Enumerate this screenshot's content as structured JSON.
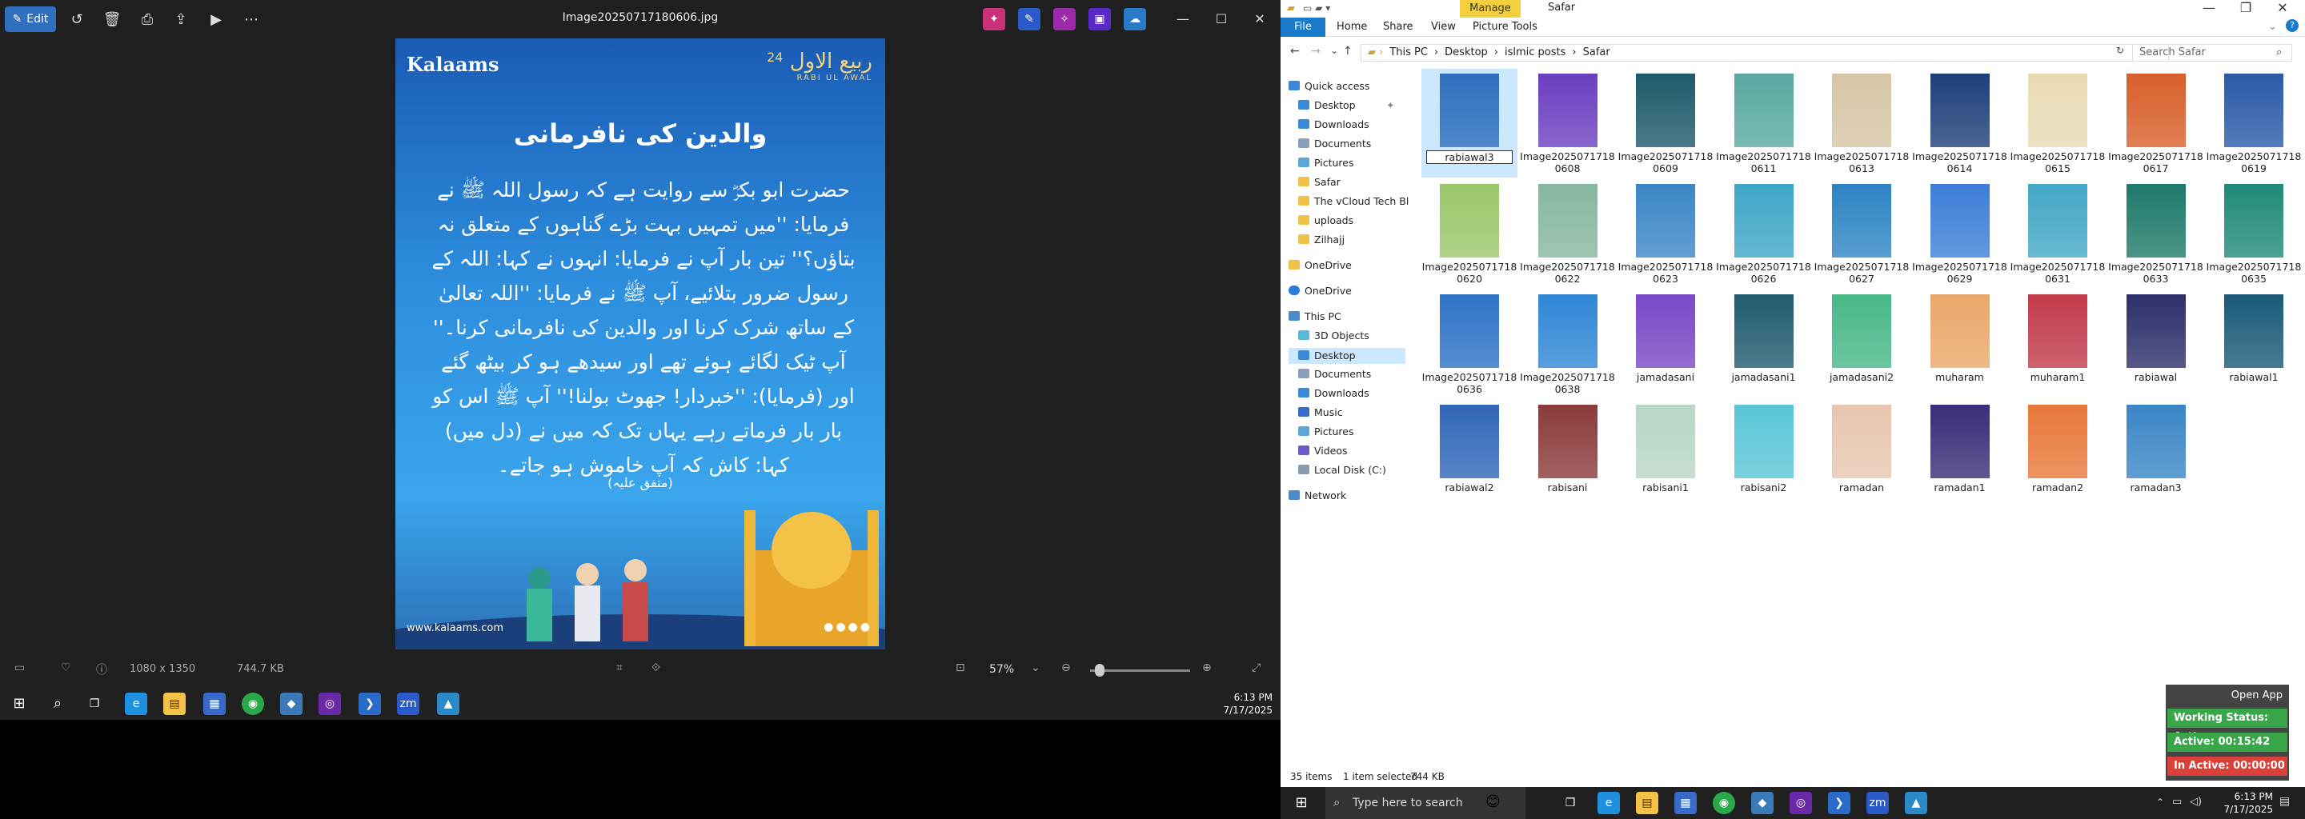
{
  "viewer": {
    "edit_label": "Edit",
    "title": "Image20250717180606.jpg",
    "dimensions": "1080 x 1350",
    "file_size": "744.7 KB",
    "zoom": "57%",
    "zoom_fraction": 0.05
  },
  "post": {
    "logo_text": "Kalaams",
    "badge_text": "ربیع الاول",
    "badge_number": "24",
    "badge_sub": "RABI UL AWAL",
    "heading": "والدین کی نافرمانی",
    "body": "حضرت ابو بکرؓ سے روایت ہے کہ رسول اللہ ﷺ نے فرمایا: ''میں تمہیں بہت بڑے گناہوں کے متعلق نہ بتاؤں؟'' تین بار آپ نے فرمایا: انہوں نے کہا: اللہ کے رسول ضرور بتلائیے، آپ ﷺ نے فرمایا: ''اللہ تعالیٰ کے ساتھ شرک کرنا اور والدین کی نافرمانی کرنا۔'' آپ ٹیک لگائے ہوئے تھے اور سیدھے ہو کر بیٹھ گئے اور (فرمایا): ''خبردار! جھوٹ بولنا!'' آپ ﷺ اس کو بار بار فرماتے رہے یہاں تک کہ میں نے (دل میں) کہا: کاش کہ آپ خاموش ہو جاتے۔",
    "reference": "(متفق علیہ)",
    "footer": "www.kalaams.com"
  },
  "taskbar_top": {
    "time": "6:13 PM",
    "date": "7/17/2025"
  },
  "explorer": {
    "manage_tab": "Manage",
    "window_title": "Safar",
    "ribbon": {
      "file": "File",
      "home": "Home",
      "share": "Share",
      "view": "View",
      "picture_tools": "Picture Tools"
    },
    "breadcrumb": [
      "This PC",
      "Desktop",
      "islmic posts",
      "Safar"
    ],
    "search_placeholder": "Search Safar",
    "nav": {
      "quick_access": "Quick access",
      "desktop": "Desktop",
      "downloads": "Downloads",
      "documents": "Documents",
      "pictures": "Pictures",
      "safar": "Safar",
      "vcloud": "The vCloud Tech Bl",
      "uploads": "uploads",
      "zilhajj": "Zilhajj",
      "onedrive1": "OneDrive",
      "onedrive2": "OneDrive",
      "this_pc": "This PC",
      "objects3d": "3D Objects",
      "desktop2": "Desktop",
      "documents2": "Documents",
      "downloads2": "Downloads",
      "music": "Music",
      "pictures2": "Pictures",
      "videos": "Videos",
      "local_disk": "Local Disk (C:)",
      "network": "Network"
    },
    "files": [
      {
        "label": "rabiawal3",
        "color": "#2f6fbe"
      },
      {
        "label": "Image20250717180608",
        "color": "#6a3fc1"
      },
      {
        "label": "Image20250717180609",
        "color": "#1d5a6a"
      },
      {
        "label": "Image20250717180611",
        "color": "#59a8a0"
      },
      {
        "label": "Image20250717180613",
        "color": "#d6c6a6"
      },
      {
        "label": "Image20250717180614",
        "color": "#1e3f7a"
      },
      {
        "label": "Image20250717180615",
        "color": "#e8dbb4"
      },
      {
        "label": "Image20250717180617",
        "color": "#d85f2a"
      },
      {
        "label": "Image20250717180619",
        "color": "#2a5aa8"
      },
      {
        "label": "Image20250717180620",
        "color": "#9bc76a"
      },
      {
        "label": "Image20250717180622",
        "color": "#86b7a0"
      },
      {
        "label": "Image20250717180623",
        "color": "#3b86c6"
      },
      {
        "label": "Image20250717180626",
        "color": "#3ea6c8"
      },
      {
        "label": "Image20250717180627",
        "color": "#2d84c4"
      },
      {
        "label": "Image20250717180629",
        "color": "#3c7fd8"
      },
      {
        "label": "Image20250717180631",
        "color": "#43a7c6"
      },
      {
        "label": "Image20250717180633",
        "color": "#1e7a6a"
      },
      {
        "label": "Image20250717180635",
        "color": "#208a78"
      },
      {
        "label": "Image20250717180636",
        "color": "#2d72c6"
      },
      {
        "label": "Image20250717180638",
        "color": "#2f86d6"
      },
      {
        "label": "jamadasani",
        "color": "#7a48c6"
      },
      {
        "label": "jamadasani1",
        "color": "#1f5a6e"
      },
      {
        "label": "jamadasani2",
        "color": "#48b888"
      },
      {
        "label": "muharam",
        "color": "#e9a86a"
      },
      {
        "label": "muharam1",
        "color": "#c23a4a"
      },
      {
        "label": "rabiawal",
        "color": "#2c2f6a"
      },
      {
        "label": "rabiawal1",
        "color": "#1a5a78"
      },
      {
        "label": "rabiawal2",
        "color": "#2f66b8"
      },
      {
        "label": "rabisani",
        "color": "#8a3a3a"
      },
      {
        "label": "rabisani1",
        "color": "#b8d6c6"
      },
      {
        "label": "rabisani2",
        "color": "#5ac6d6"
      },
      {
        "label": "ramadan",
        "color": "#e8c6b0"
      },
      {
        "label": "ramadan1",
        "color": "#3a2c78"
      },
      {
        "label": "ramadan2",
        "color": "#e8783a"
      },
      {
        "label": "ramadan3",
        "color": "#3a86c6"
      }
    ],
    "status": {
      "items": "35 items",
      "selected": "1 item selected",
      "size": "744 KB"
    }
  },
  "widget": {
    "open_app": "Open App",
    "working_status": "Working Status: Active",
    "active": "Active: 00:15:42",
    "inactive": "In Active: 00:00:00"
  },
  "taskbar_bottom": {
    "search_placeholder": "Type here to search",
    "time": "6:13 PM",
    "date": "7/17/2025"
  },
  "colors": {
    "accent": "#1979ca",
    "selection": "#cce8ff",
    "manage": "#f4d03f",
    "widget_green": "#3aa64a",
    "widget_red": "#d9413a"
  }
}
